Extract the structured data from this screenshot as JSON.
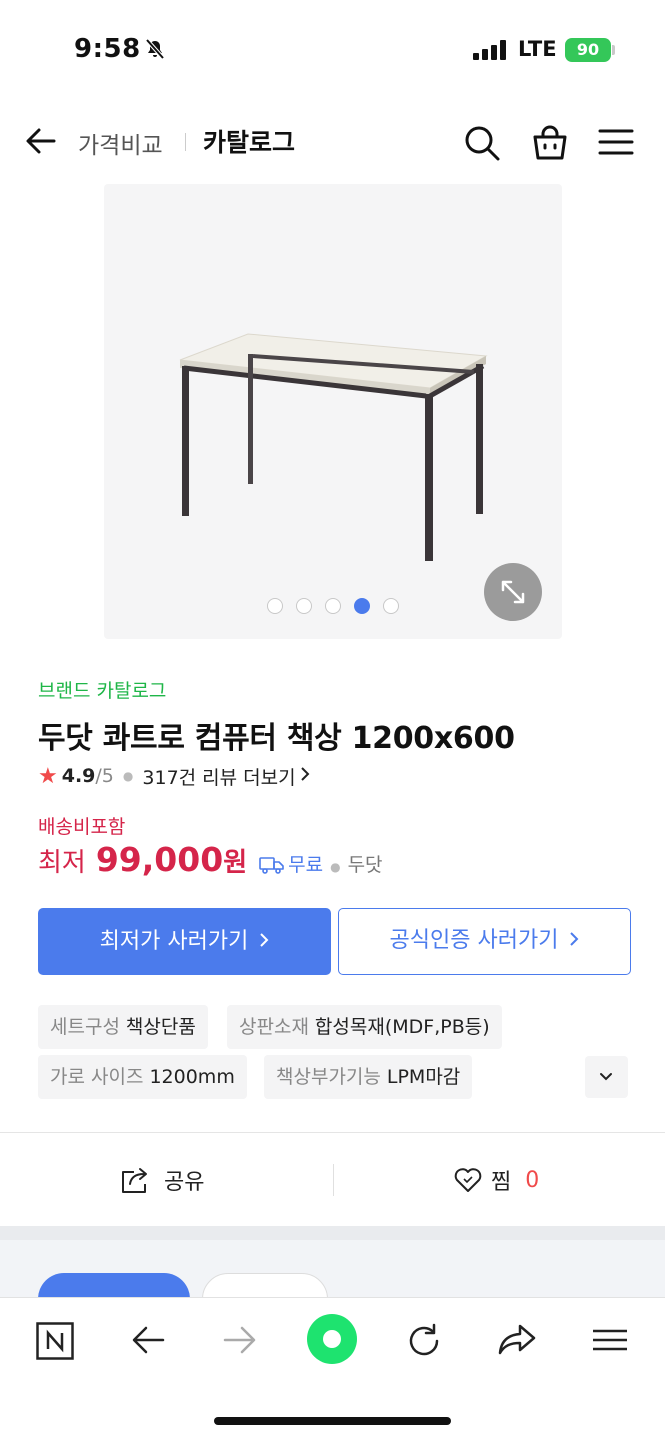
{
  "status_bar": {
    "time": "9:58",
    "network": "LTE",
    "battery": "90"
  },
  "header": {
    "section": "가격비교",
    "title": "카탈로그"
  },
  "gallery": {
    "total_images": 5,
    "active_index": 3
  },
  "product": {
    "brand_tag": "브랜드 카탈로그",
    "name": "두닷 콰트로 컴퓨터 책상 1200x600",
    "rating": "4.9",
    "rating_max": "/5",
    "reviews": "317건 리뷰 더보기",
    "shipping_included": "배송비포함",
    "price_prefix": "최저",
    "price": "99,000",
    "price_unit": "원",
    "shipping": "무료",
    "seller": "두닷"
  },
  "buttons": {
    "buy_lowest": "최저가 사러가기",
    "buy_official": "공식인증 사러가기"
  },
  "specs": [
    {
      "key": "세트구성",
      "value": "책상단품"
    },
    {
      "key": "상판소재",
      "value": "합성목재(MDF,PB등)"
    },
    {
      "key": "가로 사이즈",
      "value": "1200mm"
    },
    {
      "key": "책상부가기능",
      "value": "LPM마감"
    }
  ],
  "actions": {
    "share": "공유",
    "like": "찜",
    "like_count": "0"
  },
  "colors": {
    "accent": "#4b7bec",
    "price": "#d5254a",
    "brand": "#1fb648",
    "battery": "#34c759"
  }
}
